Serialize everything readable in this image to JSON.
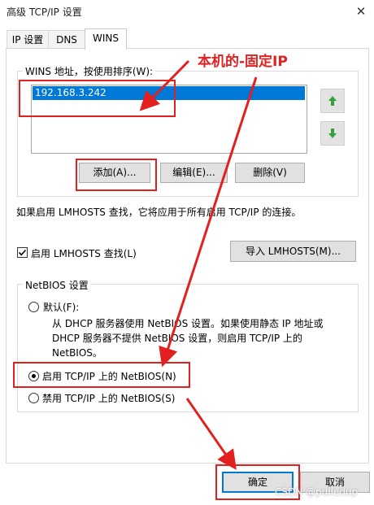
{
  "window": {
    "title": "高级 TCP/IP 设置",
    "close_glyph": "✕"
  },
  "tabs": [
    {
      "label": "IP 设置"
    },
    {
      "label": "DNS"
    },
    {
      "label": "WINS"
    }
  ],
  "wins": {
    "group_label": "WINS 地址，按使用排序(W):",
    "addresses": [
      "192.168.3.242"
    ],
    "add_button": "添加(A)...",
    "edit_button": "编辑(E)...",
    "delete_button": "删除(V)"
  },
  "lmhosts": {
    "description": "如果启用 LMHOSTS 查找，它将应用于所有启用 TCP/IP 的连接。",
    "checkbox_label": "启用 LMHOSTS 查找(L)",
    "checked": true,
    "import_button": "导入 LMHOSTS(M)..."
  },
  "netbios": {
    "group_label": "NetBIOS 设置",
    "default_label": "默认(F):",
    "default_desc_line1": "从 DHCP 服务器使用 NetBIOS 设置。如果使用静态 IP 地址或",
    "default_desc_line2": "DHCP 服务器不提供 NetBIOS 设置，则启用 TCP/IP 上的",
    "default_desc_line3": "NetBIOS。",
    "enable_label": "启用 TCP/IP 上的 NetBIOS(N)",
    "disable_label": "禁用 TCP/IP 上的 NetBIOS(S)",
    "selected": "enable"
  },
  "footer": {
    "ok_button": "确定",
    "cancel_button": "取消"
  },
  "annotation": {
    "text": "本机的-固定IP",
    "color": "#e32020"
  },
  "watermark": "CSDN @pulledup"
}
